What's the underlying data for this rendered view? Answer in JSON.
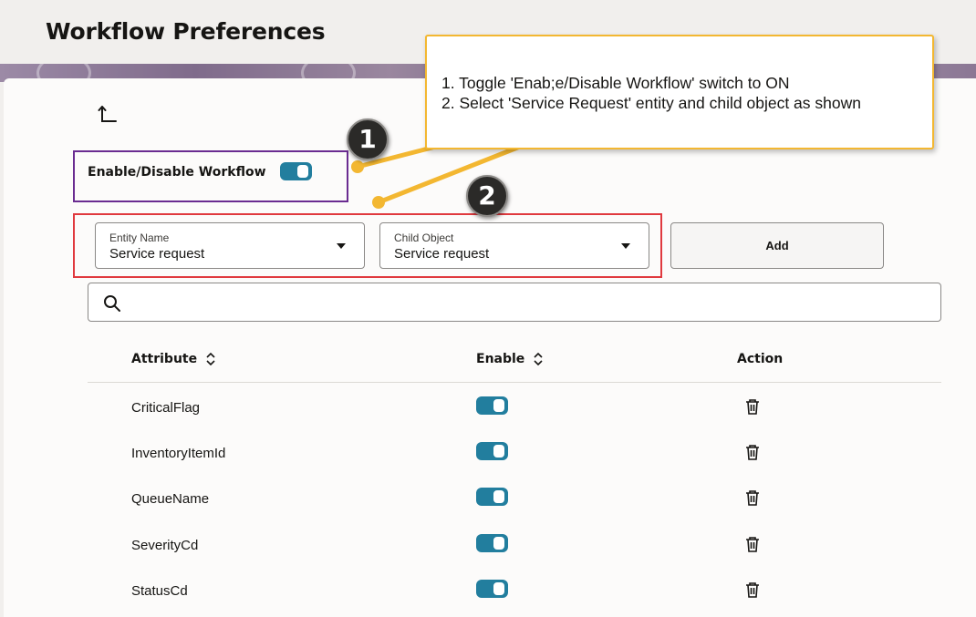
{
  "page": {
    "title": "Workflow Preferences"
  },
  "callout": {
    "lines": [
      "1. Toggle 'Enab;e/Disable Workflow' switch to ON",
      "2. Select 'Service Request' entity and child object as shown"
    ],
    "badges": [
      "1",
      "2"
    ]
  },
  "workflow": {
    "enable_label": "Enable/Disable Workflow",
    "enabled": true
  },
  "entity": {
    "label": "Entity Name",
    "value": "Service request"
  },
  "child": {
    "label": "Child Object",
    "value": "Service request"
  },
  "add_label": "Add",
  "search": {
    "value": "",
    "placeholder": ""
  },
  "table": {
    "columns": [
      "Attribute",
      "Enable",
      "Action"
    ],
    "rows": [
      {
        "attribute": "CriticalFlag",
        "enabled": true
      },
      {
        "attribute": "InventoryItemId",
        "enabled": true
      },
      {
        "attribute": "QueueName",
        "enabled": true
      },
      {
        "attribute": "SeverityCd",
        "enabled": true
      },
      {
        "attribute": "StatusCd",
        "enabled": true
      }
    ]
  },
  "colors": {
    "switch_on": "#227e9e",
    "highlight_purple": "#6a2c91",
    "highlight_red": "#e0393e",
    "callout_border": "#f3b731"
  },
  "icons": [
    "back-arrow-icon",
    "caret-down-icon",
    "search-icon",
    "sort-icon",
    "trash-icon"
  ]
}
